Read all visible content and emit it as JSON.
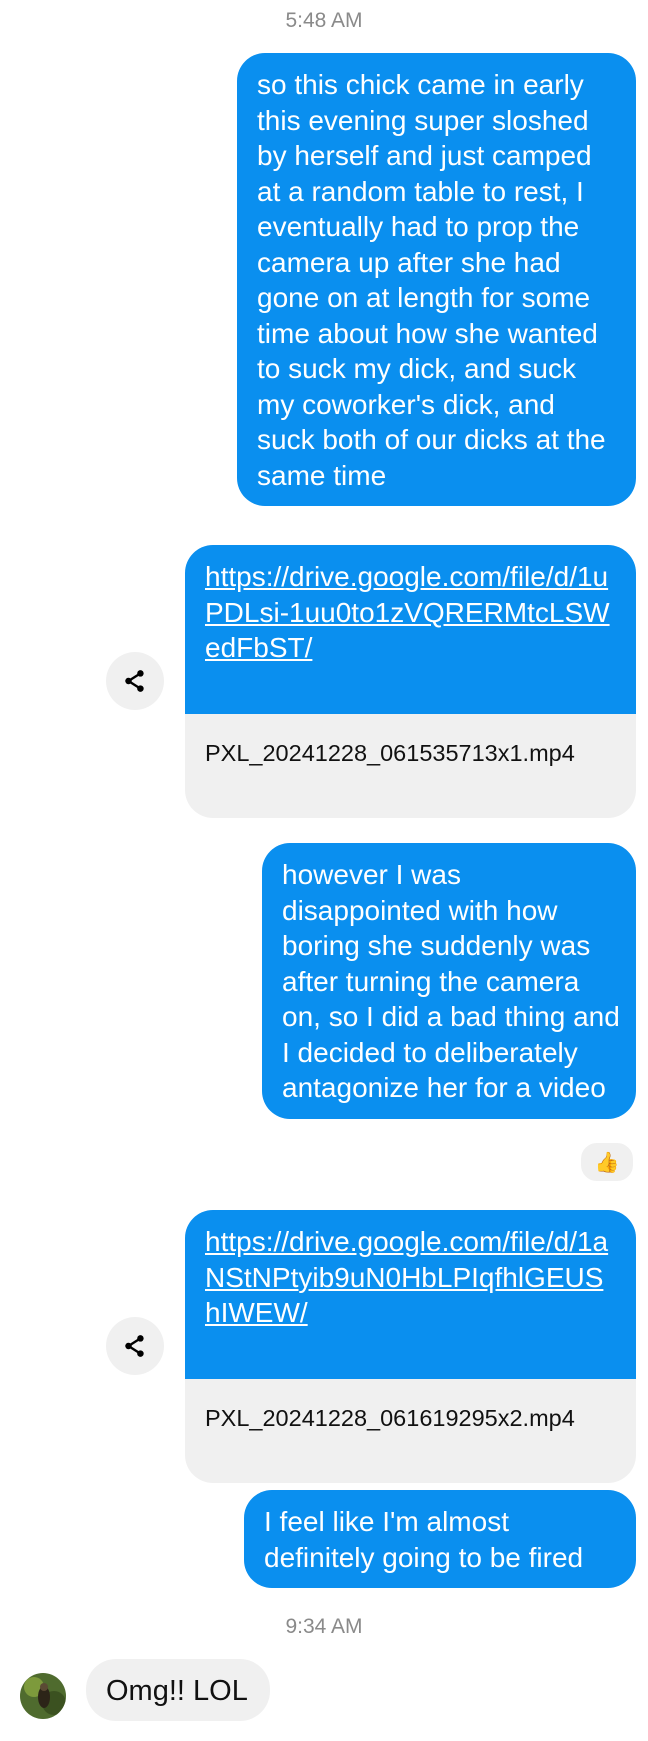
{
  "thread": {
    "timestamp_1": "5:48 AM",
    "timestamp_2": "9:34 AM"
  },
  "messages": {
    "m1": "so this chick came in early this evening super sloshed by herself and just camped at a random table to rest, I eventually had to prop the camera up after she had gone on at length for some time about how she wanted to suck my dick, and suck my coworker's dick, and suck both of our dicks at the same time",
    "m2_link": "https://drive.google.com/file/d/1uPDLsi-1uu0to1zVQRERMtcLSWedFbST/",
    "m2_file": "PXL_20241228_061535713x1.mp4",
    "m3": "however I was disappointed with how boring she suddenly was after turning the camera on, so I did a bad thing and I decided to deliberately antagonize her for a video",
    "m3_reaction": "👍",
    "m4_link": "https://drive.google.com/file/d/1aNStNPtyib9uN0HbLPIqfhlGEUShIWEW/",
    "m4_file": "PXL_20241228_061619295x2.mp4",
    "m5": "I feel like I'm almost definitely going to be fired",
    "m6": "Omg!! LOL"
  },
  "icons": {
    "share": "share-icon",
    "reaction": "thumbs-up-emoji",
    "avatar": "contact-avatar"
  },
  "colors": {
    "outgoing_bubble": "#0a8fef",
    "incoming_bubble": "#f0f0f0",
    "timestamp": "#8a8a8a"
  }
}
